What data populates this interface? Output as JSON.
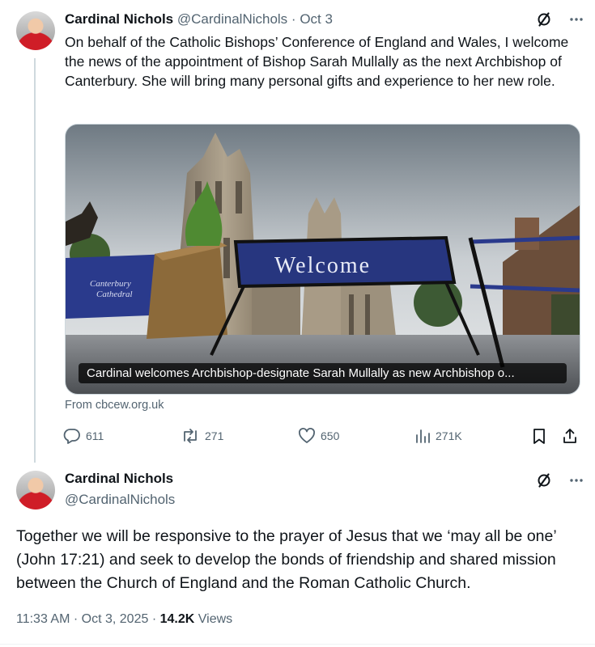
{
  "tweet1": {
    "author_name": "Cardinal Nichols",
    "handle": "@CardinalNichols",
    "separator": "·",
    "date": "Oct 3",
    "text": "On behalf of the Catholic Bishops’ Conference of England and Wales, I welcome the news of the appointment of Bishop Sarah Mullally as the next Archbishop of Canterbury. She will bring many personal gifts and experience to her new role.",
    "card": {
      "caption": "Cardinal welcomes Archbishop-designate Sarah Mullally as new Archbishop o...",
      "banner_left": "Canterbury Cathedral",
      "banner_main": "Welcome",
      "source": "From cbcew.org.uk"
    },
    "actions": {
      "replies": "611",
      "reposts": "271",
      "likes": "650",
      "views": "271K"
    }
  },
  "tweet2": {
    "author_name": "Cardinal Nichols",
    "handle": "@CardinalNichols",
    "text": "Together we will be responsive to the prayer of Jesus that we ‘may all be one’ (John 17:21) and seek to develop the bonds of friendship and shared mission between the Church of England and the Roman Catholic Church.",
    "time": "11:33 AM",
    "separator": "·",
    "date": "Oct 3, 2025",
    "separator2": "·",
    "views_count": "14.2K",
    "views_label": "Views"
  },
  "icons": {
    "grok": "grok-slash-icon",
    "more": "more-dots-icon",
    "reply": "reply-bubble-icon",
    "repost": "repost-arrows-icon",
    "like": "heart-icon",
    "views": "bar-chart-icon",
    "bookmark": "bookmark-icon",
    "share": "share-upload-icon"
  },
  "colors": {
    "text": "#0f1419",
    "muted": "#536471",
    "banner_blue": "#2a3a8c"
  }
}
